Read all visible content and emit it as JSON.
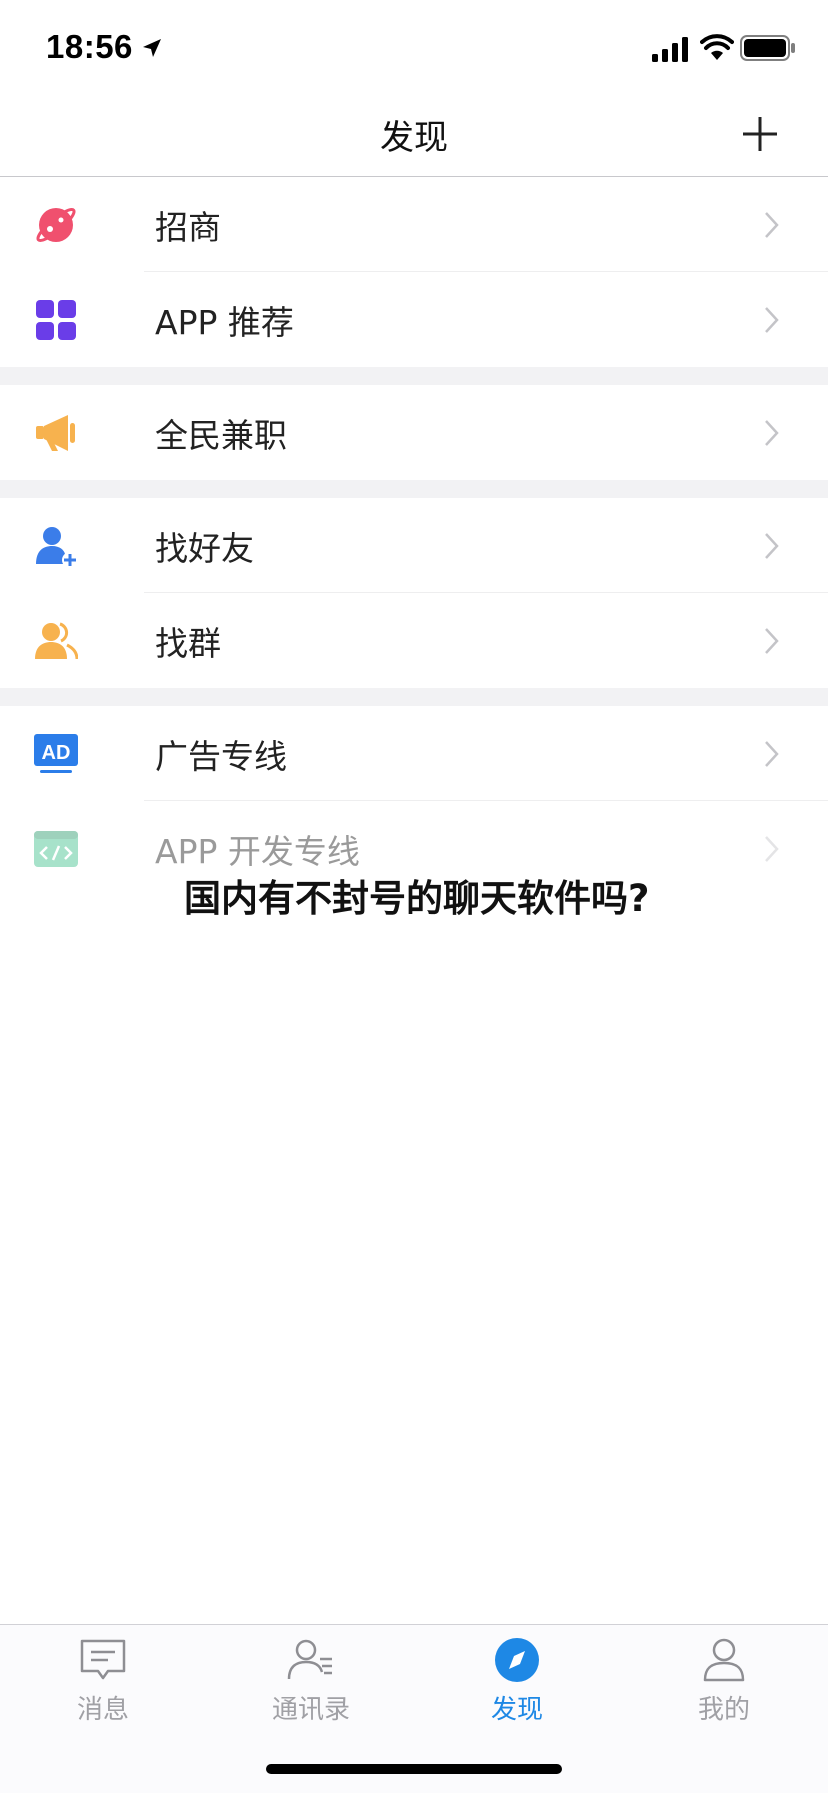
{
  "status_bar": {
    "time": "18:56",
    "icons": [
      "location-arrow-icon",
      "signal-icon",
      "wifi-icon",
      "battery-icon"
    ]
  },
  "nav": {
    "title": "发现",
    "right_icon": "plus-icon"
  },
  "groups": [
    {
      "items": [
        {
          "label": "招商",
          "icon": "planet-icon",
          "color": "#f0506e"
        },
        {
          "label": "APP 推荐",
          "icon": "app-grid-icon",
          "color": "#6a3de8"
        }
      ]
    },
    {
      "items": [
        {
          "label": "全民兼职",
          "icon": "megaphone-icon",
          "color": "#f7b24e"
        }
      ]
    },
    {
      "items": [
        {
          "label": "找好友",
          "icon": "add-friend-icon",
          "color": "#3b7de9"
        },
        {
          "label": "找群",
          "icon": "group-icon",
          "color": "#f7b24e"
        }
      ]
    },
    {
      "items": [
        {
          "label": "广告专线",
          "icon": "ad-icon",
          "color": "#2b7de9"
        },
        {
          "label": "APP 开发专线",
          "icon": "code-window-icon",
          "color": "#3ec08b"
        }
      ]
    }
  ],
  "headline": "国内有不封号的聊天软件吗?",
  "tabs": [
    {
      "label": "消息",
      "icon": "message-icon",
      "active": false
    },
    {
      "label": "通讯录",
      "icon": "contacts-icon",
      "active": false
    },
    {
      "label": "发现",
      "icon": "compass-icon",
      "active": true
    },
    {
      "label": "我的",
      "icon": "profile-icon",
      "active": false
    }
  ],
  "colors": {
    "accent": "#1e88e5",
    "tab_inactive": "#a0a0a5",
    "group_gap": "#f2f2f4"
  }
}
